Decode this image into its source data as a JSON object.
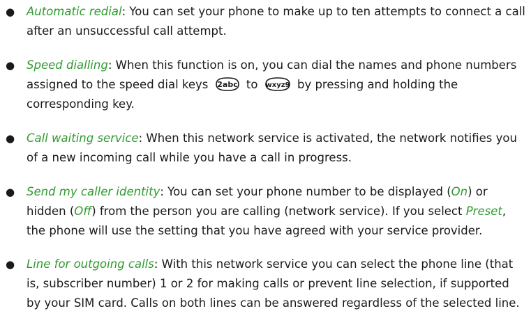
{
  "items": [
    {
      "term": "Automatic redial",
      "text": ": You can set your phone to make up to ten attempts to connect a call after an unsuccessful call attempt."
    },
    {
      "term": "Speed dialling",
      "text_a": ": When this function is on, you can dial the names and phone numbers assigned to the speed dial keys",
      "key1_label": "2abc",
      "text_b": "to",
      "key2_label": "wxyz9",
      "text_c": "by pressing and holding the corresponding key."
    },
    {
      "term": "Call waiting service",
      "text": ": When this network service is activated, the network notifies you of a new incoming call while you have a call in progress."
    },
    {
      "term": "Send my caller identity",
      "text_a": ": You can set your phone number to be displayed (",
      "opt_on": "On",
      "text_b": ") or hidden (",
      "opt_off": "Off",
      "text_c": ") from the person you are calling (network service). If you select",
      "opt_preset": "Preset",
      "text_d": ", the phone will use the setting that you have agreed with your service provider."
    },
    {
      "term": "Line for outgoing calls",
      "text": ": With this network service you can select the phone line (that is, subscriber number) 1 or 2 for making calls or prevent line selection, if supported by your SIM card. Calls on both lines can be answered regardless of the selected line."
    }
  ],
  "colors": {
    "term": "#2e9a2e",
    "text": "#1a1a1a"
  },
  "icons": {
    "key1": "key-2abc-icon",
    "key2": "key-wxyz9-icon"
  }
}
